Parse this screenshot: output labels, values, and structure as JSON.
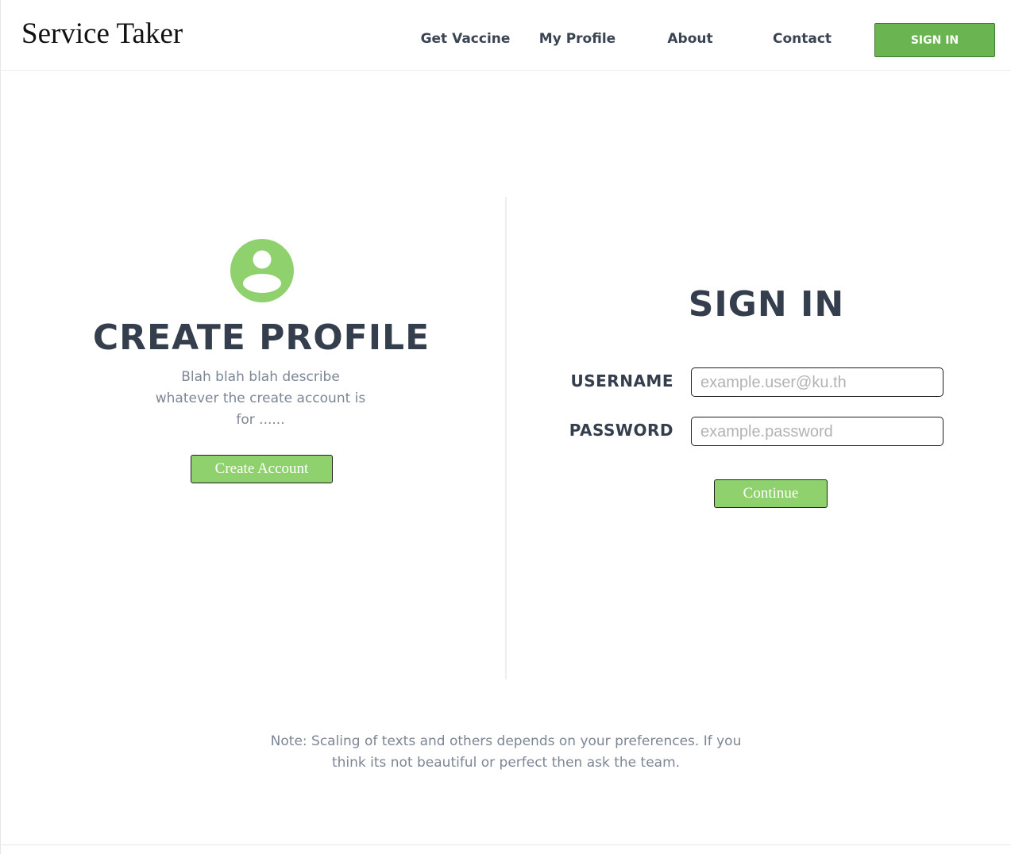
{
  "header": {
    "brand": "Service Taker",
    "nav": [
      "Get Vaccine",
      "My Profile",
      "About",
      "Contact"
    ],
    "signin_button": "SIGN IN"
  },
  "create_profile": {
    "icon": "user-circle-icon",
    "title": "CREATE PROFILE",
    "description": "Blah blah blah describe whatever the create account is for ......",
    "button": "Create Account"
  },
  "signin": {
    "title": "SIGN IN",
    "username_label": "USERNAME",
    "username_placeholder": "example.user@ku.th",
    "password_label": "PASSWORD",
    "password_placeholder": "example.password",
    "continue_button": "Continue"
  },
  "note": "Note: Scaling of texts and others depends on your preferences. If you think its not beautiful or perfect then ask the team.",
  "colors": {
    "accent_green": "#8fd16c",
    "header_button_green": "#6ab552",
    "heading_text": "#343e4c",
    "muted_text": "#7c8695"
  }
}
